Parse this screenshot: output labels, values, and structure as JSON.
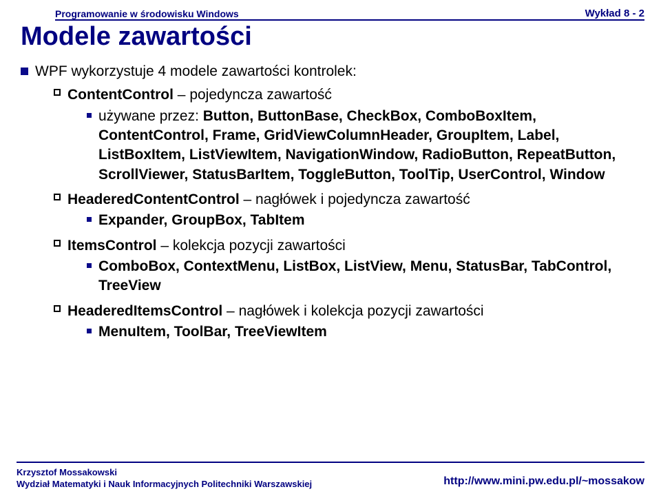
{
  "header": {
    "course": "Programowanie w środowisku Windows",
    "lecture": "Wykład 8 - 2"
  },
  "title": "Modele zawartości",
  "bullets": {
    "l1_intro": "WPF wykorzystuje 4 modele zawartości kontrolek:",
    "m1": {
      "name": "ContentControl",
      "desc": " – pojedyncza zawartość",
      "sub_intro": "używane przez: ",
      "sub_list": "Button, ButtonBase, CheckBox, ComboBoxItem, ContentControl, Frame, GridViewColumnHeader, GroupItem, Label, ListBoxItem, ListViewItem, NavigationWindow, RadioButton, RepeatButton, ScrollViewer, StatusBarItem, ToggleButton, ToolTip, UserControl, Window"
    },
    "m2": {
      "name": "HeaderedContentControl",
      "desc": " – nagłówek i pojedyncza zawartość",
      "sub_list": "Expander, GroupBox, TabItem"
    },
    "m3": {
      "name": "ItemsControl",
      "desc": " – kolekcja pozycji zawartości",
      "sub_list": "ComboBox, ContextMenu, ListBox, ListView, Menu, StatusBar, TabControl, TreeView"
    },
    "m4": {
      "name": "HeaderedItemsControl",
      "desc": " – nagłówek i kolekcja pozycji zawartości",
      "sub_list": "MenuItem, ToolBar, TreeViewItem"
    }
  },
  "footer": {
    "author": "Krzysztof Mossakowski",
    "affiliation": "Wydział Matematyki i Nauk Informacyjnych Politechniki Warszawskiej",
    "url": "http://www.mini.pw.edu.pl/~mossakow"
  }
}
